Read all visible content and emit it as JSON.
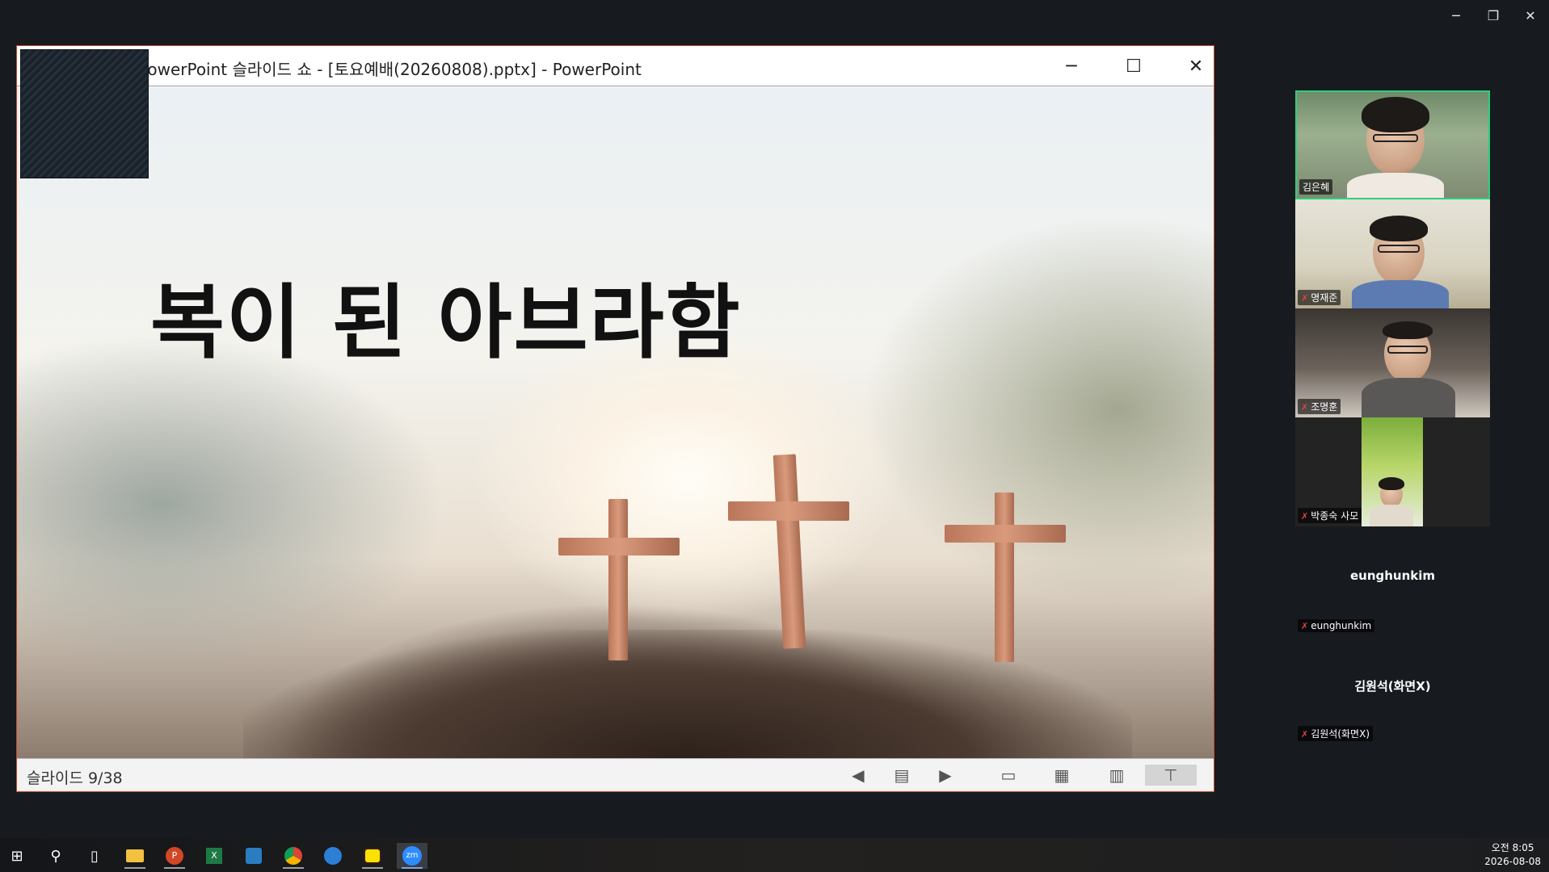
{
  "zoom_window": {
    "controls": {
      "minimize": "─",
      "restore": "❐",
      "close": "✕"
    }
  },
  "powerpoint": {
    "title": "PowerPoint 슬라이드 쇼 - [토요예배(20260808).pptx] - PowerPoint",
    "window_buttons": {
      "minimize": "─",
      "maximize": "☐",
      "close": "✕"
    },
    "slide": {
      "heading": "복이 된 아브라함"
    },
    "statusbar": {
      "slide_counter": "슬라이드 9/38"
    }
  },
  "participants": [
    {
      "name": "김은혜",
      "muted": false,
      "active": true
    },
    {
      "name": "명재준",
      "muted": true,
      "active": false
    },
    {
      "name": "조명훈",
      "muted": true,
      "active": false
    },
    {
      "name": "박종숙 사모",
      "muted": true,
      "active": false
    },
    {
      "display_name": "eunghunkim",
      "name": "eunghunkim",
      "muted": true,
      "active": false
    },
    {
      "display_name": "김원석(화면X)",
      "name": "김원석(화면X)",
      "muted": true,
      "active": false
    }
  ],
  "taskbar": {
    "icons": [
      "windows-start",
      "search",
      "task-view",
      "file-explorer",
      "powerpoint",
      "excel",
      "app-blue",
      "chrome",
      "app-arrow",
      "kakaotalk",
      "zoom"
    ],
    "clock": {
      "time": "오전 8:05",
      "date": "2026-08-08"
    },
    "zoom_label": "zm"
  },
  "colors": {
    "active_speaker_border": "#2fcf7b",
    "ppt_border": "#c44a2a",
    "mute_icon": "#e04141"
  }
}
